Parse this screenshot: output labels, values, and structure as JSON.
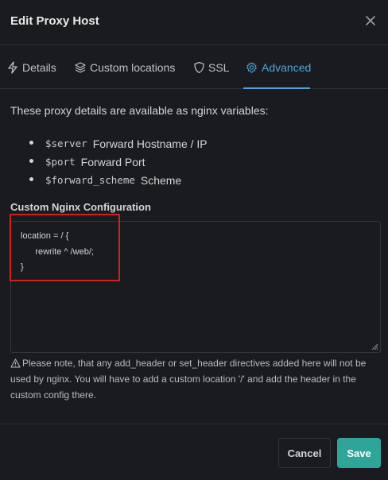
{
  "dialog": {
    "title": "Edit Proxy Host"
  },
  "tabs": [
    {
      "label": "Details",
      "icon": "bolt-icon",
      "active": false
    },
    {
      "label": "Custom locations",
      "icon": "layers-icon",
      "active": false
    },
    {
      "label": "SSL",
      "icon": "shield-icon",
      "active": false
    },
    {
      "label": "Advanced",
      "icon": "gear-icon",
      "active": true
    }
  ],
  "advanced": {
    "intro": "These proxy details are available as nginx variables:",
    "variables": [
      {
        "name": "$server",
        "description": "Forward Hostname / IP"
      },
      {
        "name": "$port",
        "description": "Forward Port"
      },
      {
        "name": "$forward_scheme",
        "description": "Scheme"
      }
    ],
    "config_label": "Custom Nginx Configuration",
    "config_value": "location = / {\n      rewrite ^ /web/;\n}",
    "note": "Please note, that any add_header or set_header directives added here will not be used by nginx. You will have to add a custom location '/' and add the header in the custom config there."
  },
  "footer": {
    "cancel_label": "Cancel",
    "save_label": "Save"
  },
  "colors": {
    "accent": "#4ea4d9",
    "save": "#2fa498",
    "highlight": "#d21f1f",
    "background": "#1a1b1e"
  }
}
